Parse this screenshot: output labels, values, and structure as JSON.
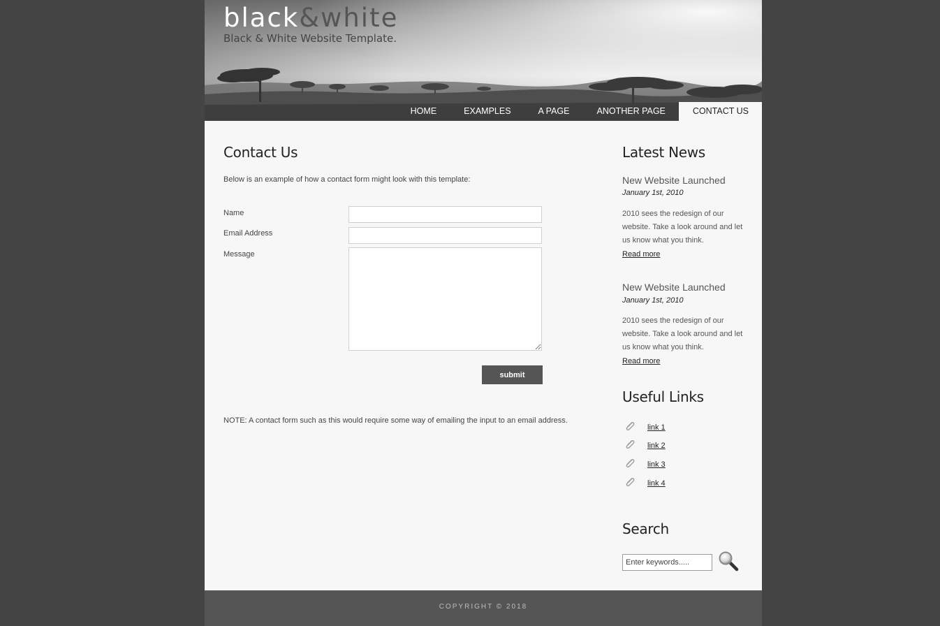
{
  "header": {
    "logo_black": "black",
    "logo_amp": "&",
    "logo_white": "white",
    "tagline": "Black & White Website Template."
  },
  "menu": {
    "items": [
      {
        "label": "Home",
        "active": false
      },
      {
        "label": "Examples",
        "active": false
      },
      {
        "label": "A Page",
        "active": false
      },
      {
        "label": "Another Page",
        "active": false
      },
      {
        "label": "Contact Us",
        "active": true
      }
    ]
  },
  "content": {
    "title": "Contact Us",
    "intro": "Below is an example of how a contact form might look with this template:",
    "form": {
      "name_label": "Name",
      "name_value": "",
      "email_label": "Email Address",
      "email_value": "",
      "message_label": "Message",
      "message_value": "",
      "submit_label": "submit"
    },
    "note": "NOTE: A contact form such as this would require some way of emailing the input to an email address."
  },
  "sidebar": {
    "news_heading": "Latest News",
    "news": [
      {
        "title": "New Website Launched",
        "date": "January 1st, 2010",
        "body": "2010 sees the redesign of our website. Take a look around and let us know what you think.",
        "read_more": "Read more"
      },
      {
        "title": "New Website Launched",
        "date": "January 1st, 2010",
        "body": "2010 sees the redesign of our website. Take a look around and let us know what you think.",
        "read_more": "Read more"
      }
    ],
    "links_heading": "Useful Links",
    "links": [
      {
        "label": "link 1",
        "icon": "paperclip-icon"
      },
      {
        "label": "link 2",
        "icon": "paperclip-icon"
      },
      {
        "label": "link 3",
        "icon": "paperclip-icon"
      },
      {
        "label": "link 4",
        "icon": "paperclip-icon"
      }
    ],
    "search_heading": "Search",
    "search_placeholder": "Enter keywords.....",
    "search_icon": "magnifier-icon"
  },
  "footer": {
    "copyright": "COPYRIGHT © 2018"
  },
  "colors": {
    "background": "#444444",
    "page": "#f7f7f7",
    "button": "#555555",
    "footer": "#555555"
  }
}
